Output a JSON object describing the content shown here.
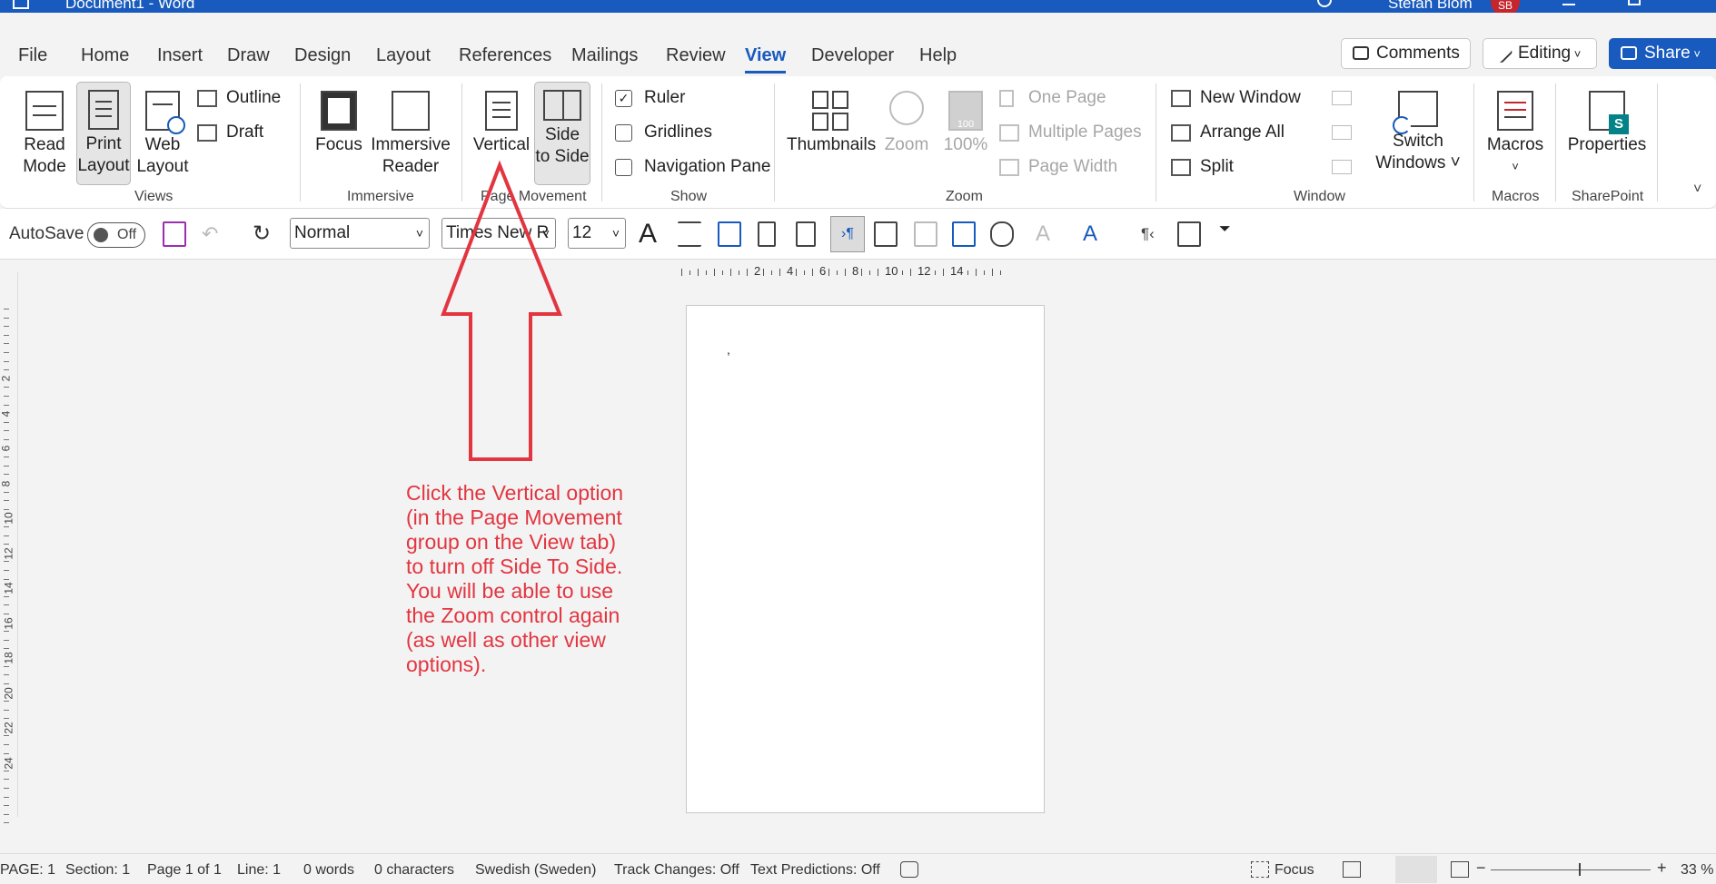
{
  "titlebar": {
    "doc_title": "Document1  -  Word",
    "user_name": "Stefan Blom",
    "avatar": "SB"
  },
  "tabs": [
    "File",
    "Home",
    "Insert",
    "Draw",
    "Design",
    "Layout",
    "References",
    "Mailings",
    "Review",
    "View",
    "Developer",
    "Help"
  ],
  "active_tab": "View",
  "header_buttons": {
    "comments": "Comments",
    "editing": "Editing",
    "share": "Share"
  },
  "ribbon": {
    "views": {
      "label": "Views",
      "read_mode": [
        "Read",
        "Mode"
      ],
      "print_layout": [
        "Print",
        "Layout"
      ],
      "web_layout": [
        "Web",
        "Layout"
      ],
      "outline": "Outline",
      "draft": "Draft"
    },
    "immersive": {
      "label": "Immersive",
      "focus": "Focus",
      "immersive_reader": [
        "Immersive",
        "Reader"
      ]
    },
    "page_movement": {
      "label": "Page Movement",
      "vertical": "Vertical",
      "side_to_side": [
        "Side",
        "to Side"
      ]
    },
    "show": {
      "label": "Show",
      "ruler": "Ruler",
      "gridlines": "Gridlines",
      "navigation_pane": "Navigation Pane"
    },
    "zoom": {
      "label": "Zoom",
      "thumbnails": "Thumbnails",
      "zoom": "Zoom",
      "percent": "100%",
      "icon_badge": "100",
      "one_page": "One Page",
      "multiple_pages": "Multiple Pages",
      "page_width": "Page Width"
    },
    "window": {
      "label": "Window",
      "new_window": "New Window",
      "arrange_all": "Arrange All",
      "split": "Split",
      "switch_windows": [
        "Switch",
        "Windows ˅"
      ]
    },
    "macros": {
      "label": "Macros",
      "button": "Macros"
    },
    "sharepoint": {
      "label": "SharePoint",
      "properties": "Properties"
    }
  },
  "qat": {
    "autosave": "AutoSave",
    "autosave_state": "Off",
    "style": "Normal",
    "font": "Times New R",
    "size": "12"
  },
  "ruler_numbers": [
    "2",
    "4",
    "6",
    "8",
    "10",
    "12",
    "14"
  ],
  "vruler_numbers": [
    "2",
    "4",
    "6",
    "8",
    "10",
    "12",
    "14",
    "16",
    "18",
    "20",
    "22",
    "24"
  ],
  "page_mark": ",",
  "annotation": "Click the Vertical option (in the Page Movement group on the View tab) to turn off Side To Side. You will be able to use the Zoom control again (as well as other view options).",
  "status": {
    "page": "PAGE: 1",
    "section": "Section: 1",
    "page_of": "Page 1 of 1",
    "line": "Line: 1",
    "words": "0 words",
    "characters": "0 characters",
    "language": "Swedish (Sweden)",
    "track_changes": "Track Changes: Off",
    "text_predictions": "Text Predictions: Off",
    "focus": "Focus",
    "zoom_minus": "−",
    "zoom_plus": "+",
    "zoom": "33 %"
  },
  "colors": {
    "brand": "#185abd",
    "annotation": "#e23540",
    "avatar": "#c4262e"
  }
}
